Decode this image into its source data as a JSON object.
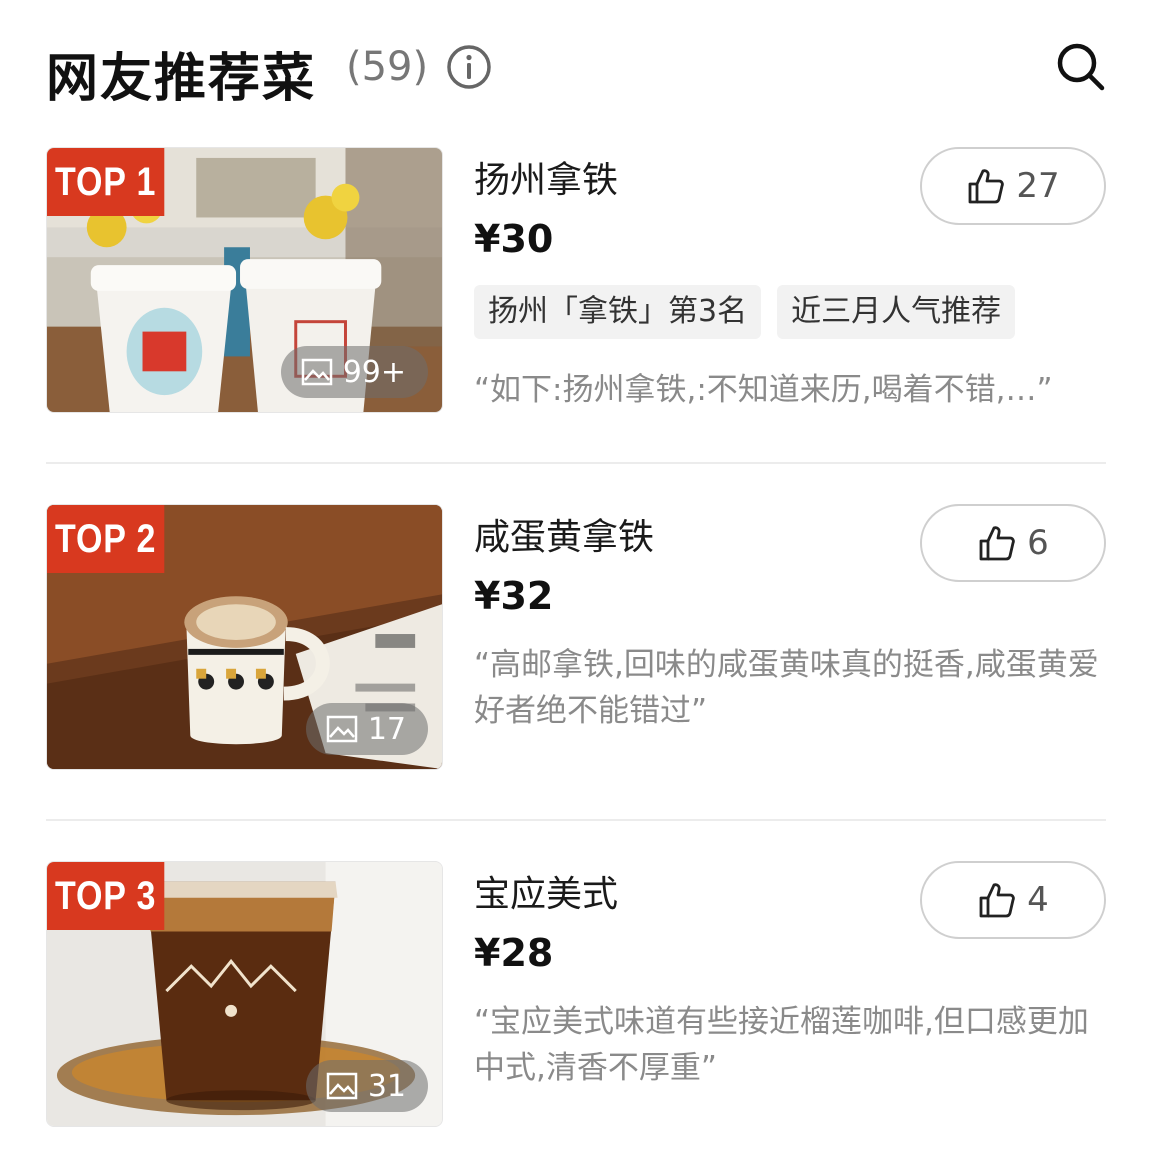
{
  "header": {
    "title": "网友推荐菜",
    "count": "(59)",
    "info_icon": "info-circle-icon",
    "search_icon": "search-icon"
  },
  "dishes": [
    {
      "rank": "TOP 1",
      "name": "扬州拿铁",
      "price": "¥30",
      "likes": "27",
      "photo_count": "99+",
      "tags": [
        "扬州「拿铁」第3名",
        "近三月人气推荐"
      ],
      "quote": "“如下:扬州拿铁,:不知道来历,喝着不错,…”",
      "photo": "Two white takeaway coffee cups with red stamp logos in front of yellow flowers"
    },
    {
      "rank": "TOP 2",
      "name": "咸蛋黄拿铁",
      "price": "¥32",
      "likes": "6",
      "photo_count": "17",
      "tags": [],
      "quote": "“高邮拿铁,回味的咸蛋黄味真的挺香,咸蛋黄爱好者绝不能错过”",
      "photo": "Latte art cup with tulip pattern on wooden table next to newspaper"
    },
    {
      "rank": "TOP 3",
      "name": "宝应美式",
      "price": "¥28",
      "likes": "4",
      "photo_count": "31",
      "tags": [],
      "quote": "“宝应美式味道有些接近榴莲咖啡,但口感更加中式,清香不厚重”",
      "photo": "Glass of iced americano on an amber glass saucer"
    }
  ],
  "colors": {
    "badge": "#d8391f",
    "price": "#111111",
    "quote": "#8a8a8a",
    "tag_bg": "#f2f2f2"
  }
}
